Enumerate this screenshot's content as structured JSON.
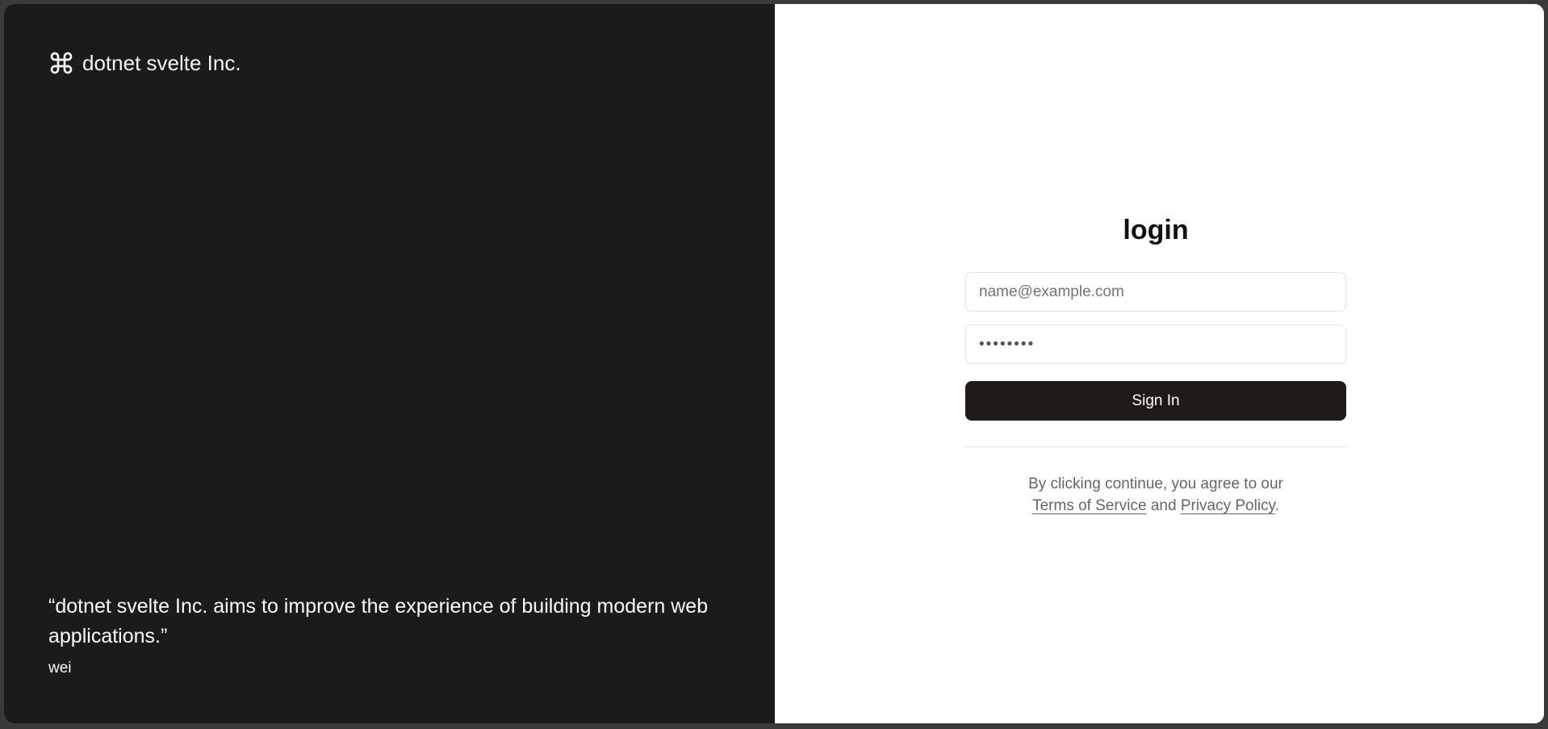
{
  "brand": {
    "icon": "command-icon",
    "name": "dotnet svelte Inc."
  },
  "testimonial": {
    "quote": "“dotnet svelte Inc. aims to improve the experience of building modern web applications.”",
    "author": "wei"
  },
  "login": {
    "title": "login",
    "email_placeholder": "name@example.com",
    "email_value": "",
    "password_value": "••••••••",
    "submit_label": "Sign In"
  },
  "terms": {
    "prefix": "By clicking continue, you agree to our",
    "terms_link": "Terms of Service",
    "and": "and",
    "privacy_link": "Privacy Policy",
    "suffix": "."
  },
  "colors": {
    "left_bg": "#1b1b1d",
    "button_bg": "#1f1b18",
    "text_muted": "#6b6360"
  }
}
